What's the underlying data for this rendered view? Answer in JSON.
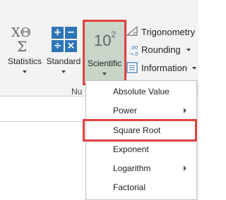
{
  "ribbon": {
    "buttons": {
      "statistics": "Statistics",
      "standard": "Standard",
      "scientific_icon_base": "10",
      "scientific_icon_exp": "2",
      "scientific": "Scientific"
    },
    "right_items": [
      "Trigonometry",
      "Rounding",
      "Information"
    ],
    "group_label": "Nu"
  },
  "menu": {
    "items": [
      {
        "label": "Absolute Value",
        "submenu": false
      },
      {
        "label": "Power",
        "submenu": true
      },
      {
        "label": "Square Root",
        "submenu": false,
        "highlighted": true
      },
      {
        "label": "Exponent",
        "submenu": false
      },
      {
        "label": "Logarithm",
        "submenu": true
      },
      {
        "label": "Factorial",
        "submenu": false
      }
    ]
  },
  "colors": {
    "highlight": "#e0403f",
    "accent": "#2e75b6"
  },
  "icons": [
    "statistics-icon",
    "standard-icon",
    "trigonometry-icon",
    "rounding-icon",
    "information-icon",
    "submenu-arrow-icon"
  ]
}
